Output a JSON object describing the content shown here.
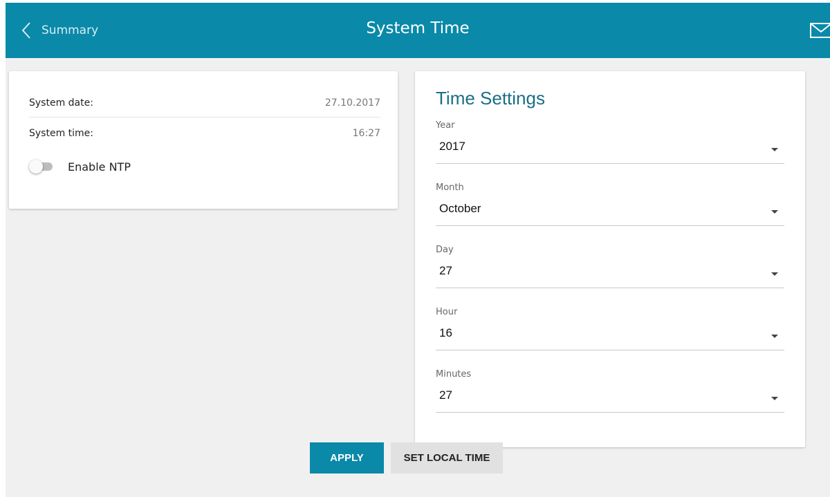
{
  "header": {
    "back_label": "Summary",
    "title": "System Time",
    "accent_color": "#0a89a9",
    "back_icon": "chevron-left-icon",
    "mail_icon": "mail-icon"
  },
  "info": {
    "date_label": "System date:",
    "date_value": "27.10.2017",
    "time_label": "System time:",
    "time_value": "16:27",
    "ntp_label": "Enable NTP",
    "ntp_enabled": false
  },
  "settings": {
    "title": "Time Settings",
    "fields": [
      {
        "label": "Year",
        "value": "2017"
      },
      {
        "label": "Month",
        "value": "October"
      },
      {
        "label": "Day",
        "value": "27"
      },
      {
        "label": "Hour",
        "value": "16"
      },
      {
        "label": "Minutes",
        "value": "27"
      }
    ]
  },
  "buttons": {
    "apply_label": "APPLY",
    "set_local_label": "SET LOCAL TIME"
  }
}
